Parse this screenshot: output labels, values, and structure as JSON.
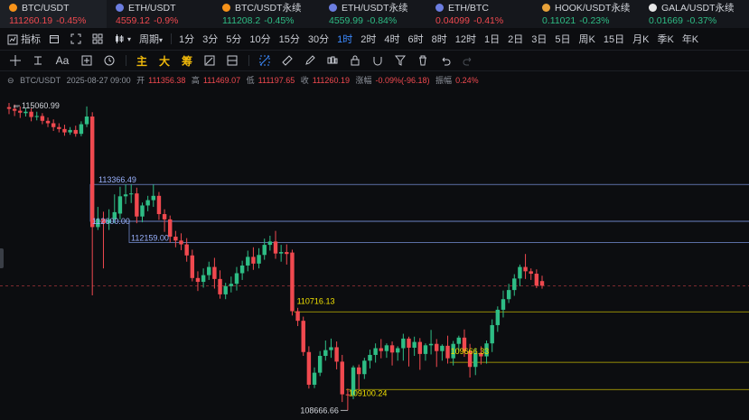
{
  "tickers": [
    {
      "name": "BTC/USDT",
      "price": "111260.19",
      "change": "-0.45%",
      "dir": "down",
      "coin": "#f7931a",
      "active": true
    },
    {
      "name": "ETH/USDT",
      "price": "4559.12",
      "change": "-0.9%",
      "dir": "down",
      "coin": "#6c7ee1",
      "active": false
    },
    {
      "name": "BTC/USDT永续",
      "price": "111208.2",
      "change": "-0.45%",
      "dir": "up",
      "coin": "#f7931a",
      "active": false
    },
    {
      "name": "ETH/USDT永续",
      "price": "4559.99",
      "change": "-0.84%",
      "dir": "up",
      "coin": "#6c7ee1",
      "active": false
    },
    {
      "name": "ETH/BTC",
      "price": "0.04099",
      "change": "-0.41%",
      "dir": "down",
      "coin": "#6c7ee1",
      "active": false
    },
    {
      "name": "HOOK/USDT永续",
      "price": "0.11021",
      "change": "-0.23%",
      "dir": "up",
      "coin": "#e8a23a",
      "active": false
    },
    {
      "name": "GALA/USDT永续",
      "price": "0.01669",
      "change": "-0.37%",
      "dir": "up",
      "coin": "#e8e8e8",
      "active": false
    }
  ],
  "toolbar": {
    "indicators_label": "指标",
    "period_label": "周期",
    "intervals": [
      "1分",
      "3分",
      "5分",
      "10分",
      "15分",
      "30分",
      "1时",
      "2时",
      "4时",
      "6时",
      "8时",
      "12时",
      "1日",
      "2日",
      "3日",
      "5日",
      "周K",
      "15日",
      "月K",
      "季K",
      "年K"
    ],
    "selected_interval": "1时"
  },
  "drawbar": {
    "text_tool": "Aa",
    "labels": [
      "主",
      "大",
      "筹"
    ]
  },
  "info": {
    "symbol": "BTC/USDT",
    "datetime": "2025-08-27 09:00",
    "open_label": "开",
    "open": "111356.38",
    "high_label": "高",
    "high": "111469.07",
    "low_label": "低",
    "low": "111197.65",
    "close_label": "收",
    "close": "111260.19",
    "change_label": "涨幅",
    "change": "-0.09%(-96.18)",
    "amplitude_label": "振幅",
    "amplitude": "0.24%"
  },
  "chart_data": {
    "type": "candlestick",
    "y_range": [
      108560,
      115250
    ],
    "current_price": 111260.19,
    "candles": [
      {
        "o": 114975,
        "h": 115060.99,
        "c": 114940,
        "l": 114830
      },
      {
        "o": 114940,
        "h": 115030,
        "c": 114900,
        "l": 114790
      },
      {
        "o": 114900,
        "h": 114990,
        "c": 114860,
        "l": 114750
      },
      {
        "o": 114850,
        "h": 114960,
        "c": 114880,
        "l": 114780
      },
      {
        "o": 114880,
        "h": 114950,
        "c": 114770,
        "l": 114680
      },
      {
        "o": 114770,
        "h": 114880,
        "c": 114790,
        "l": 114700
      },
      {
        "o": 114790,
        "h": 114850,
        "c": 114690,
        "l": 114620
      },
      {
        "o": 114690,
        "h": 114760,
        "c": 114640,
        "l": 114560
      },
      {
        "o": 114640,
        "h": 114720,
        "c": 114560,
        "l": 114480
      },
      {
        "o": 114560,
        "h": 114640,
        "c": 114520,
        "l": 114450
      },
      {
        "o": 114520,
        "h": 114610,
        "c": 114450,
        "l": 114380
      },
      {
        "o": 114450,
        "h": 114560,
        "c": 114500,
        "l": 114400
      },
      {
        "o": 114500,
        "h": 114590,
        "c": 114420,
        "l": 114360
      },
      {
        "o": 114420,
        "h": 114680,
        "c": 114620,
        "l": 114370
      },
      {
        "o": 114620,
        "h": 114990,
        "c": 114780,
        "l": 114560
      },
      {
        "o": 114780,
        "h": 114870,
        "c": 112480,
        "l": 111060
      },
      {
        "o": 112480,
        "h": 112900,
        "c": 112650,
        "l": 112420
      },
      {
        "o": 112650,
        "h": 112800,
        "c": 112560,
        "l": 111620
      },
      {
        "o": 112560,
        "h": 112850,
        "c": 112640,
        "l": 112420
      },
      {
        "o": 112640,
        "h": 113160,
        "c": 112790,
        "l": 112560
      },
      {
        "o": 112760,
        "h": 113320,
        "c": 113120,
        "l": 112640
      },
      {
        "o": 113120,
        "h": 113370,
        "c": 113160,
        "l": 112960
      },
      {
        "o": 113160,
        "h": 113366.49,
        "c": 113180,
        "l": 112980
      },
      {
        "o": 113180,
        "h": 113300,
        "c": 112700,
        "l": 112560
      },
      {
        "o": 112700,
        "h": 112990,
        "c": 112930,
        "l": 112580
      },
      {
        "o": 112930,
        "h": 113130,
        "c": 113040,
        "l": 112810
      },
      {
        "o": 113040,
        "h": 113366.49,
        "c": 113130,
        "l": 112900
      },
      {
        "o": 113130,
        "h": 113210,
        "c": 112750,
        "l": 112630
      },
      {
        "o": 112750,
        "h": 112850,
        "c": 112640,
        "l": 112380
      },
      {
        "o": 112640,
        "h": 112720,
        "c": 112280,
        "l": 112159
      },
      {
        "o": 112280,
        "h": 112400,
        "c": 112200,
        "l": 112060
      },
      {
        "o": 112200,
        "h": 112350,
        "c": 112120,
        "l": 112000
      },
      {
        "o": 112120,
        "h": 112250,
        "c": 111890,
        "l": 111760
      },
      {
        "o": 111890,
        "h": 112010,
        "c": 111420,
        "l": 111350
      },
      {
        "o": 111420,
        "h": 111560,
        "c": 111340,
        "l": 111150
      },
      {
        "o": 111340,
        "h": 111620,
        "c": 111480,
        "l": 111220
      },
      {
        "o": 111480,
        "h": 111760,
        "c": 111650,
        "l": 111380
      },
      {
        "o": 111650,
        "h": 111840,
        "c": 111400,
        "l": 111200
      },
      {
        "o": 111400,
        "h": 111580,
        "c": 111080,
        "l": 110990
      },
      {
        "o": 111080,
        "h": 111320,
        "c": 111250,
        "l": 110980
      },
      {
        "o": 111250,
        "h": 111450,
        "c": 111300,
        "l": 111120
      },
      {
        "o": 111300,
        "h": 111650,
        "c": 111520,
        "l": 111160
      },
      {
        "o": 111520,
        "h": 111780,
        "c": 111680,
        "l": 111380
      },
      {
        "o": 111680,
        "h": 111990,
        "c": 111860,
        "l": 111560
      },
      {
        "o": 111860,
        "h": 112060,
        "c": 111720,
        "l": 111590
      },
      {
        "o": 111720,
        "h": 112040,
        "c": 111900,
        "l": 111620
      },
      {
        "o": 111900,
        "h": 112240,
        "c": 112110,
        "l": 111800
      },
      {
        "o": 112110,
        "h": 112300,
        "c": 112180,
        "l": 111990
      },
      {
        "o": 112180,
        "h": 112400,
        "c": 111930,
        "l": 111820
      },
      {
        "o": 111930,
        "h": 112110,
        "c": 111960,
        "l": 111760
      },
      {
        "o": 111960,
        "h": 112120,
        "c": 111920,
        "l": 111700
      },
      {
        "o": 111950,
        "h": 112010,
        "c": 110730,
        "l": 110640
      },
      {
        "o": 110730,
        "h": 110800,
        "c": 110530,
        "l": 110420
      },
      {
        "o": 110530,
        "h": 110616.13,
        "c": 109880,
        "l": 109800
      },
      {
        "o": 109880,
        "h": 110000,
        "c": 109200,
        "l": 109120
      },
      {
        "o": 109200,
        "h": 109560,
        "c": 109450,
        "l": 109130
      },
      {
        "o": 109450,
        "h": 109900,
        "c": 109800,
        "l": 109380
      },
      {
        "o": 109800,
        "h": 110120,
        "c": 109920,
        "l": 109700
      },
      {
        "o": 109920,
        "h": 110160,
        "c": 109980,
        "l": 109760
      },
      {
        "o": 109980,
        "h": 110100,
        "c": 109680,
        "l": 109520
      },
      {
        "o": 109680,
        "h": 109820,
        "c": 109000,
        "l": 108840
      },
      {
        "o": 109000,
        "h": 109120,
        "c": 108980,
        "l": 108666.66
      },
      {
        "o": 108980,
        "h": 109600,
        "c": 109560,
        "l": 108900
      },
      {
        "o": 109560,
        "h": 109620,
        "c": 109420,
        "l": 109100.24
      },
      {
        "o": 109420,
        "h": 109760,
        "c": 109700,
        "l": 109320
      },
      {
        "o": 109700,
        "h": 109930,
        "c": 109820,
        "l": 109540
      },
      {
        "o": 109820,
        "h": 110060,
        "c": 109960,
        "l": 109660
      },
      {
        "o": 109960,
        "h": 110150,
        "c": 109900,
        "l": 109750
      },
      {
        "o": 109900,
        "h": 110060,
        "c": 110020,
        "l": 109760
      },
      {
        "o": 110020,
        "h": 110100,
        "c": 109870,
        "l": 109600
      },
      {
        "o": 109870,
        "h": 110000,
        "c": 109960,
        "l": 109700
      },
      {
        "o": 109960,
        "h": 110260,
        "c": 110160,
        "l": 109700
      },
      {
        "o": 110160,
        "h": 110200,
        "c": 109970,
        "l": 109580
      },
      {
        "o": 109970,
        "h": 110200,
        "c": 110090,
        "l": 109800
      },
      {
        "o": 110090,
        "h": 110170,
        "c": 109840,
        "l": 109510
      },
      {
        "o": 109840,
        "h": 110060,
        "c": 110020,
        "l": 109700
      },
      {
        "o": 110020,
        "h": 110340,
        "c": 110050,
        "l": 109830
      },
      {
        "o": 110050,
        "h": 110150,
        "c": 109900,
        "l": 109570
      },
      {
        "o": 109900,
        "h": 110040,
        "c": 110010,
        "l": 109700
      },
      {
        "o": 110010,
        "h": 110220,
        "c": 109750,
        "l": 109640
      },
      {
        "o": 109750,
        "h": 110110,
        "c": 110050,
        "l": 109600
      },
      {
        "o": 110050,
        "h": 110220,
        "c": 110180,
        "l": 109880
      },
      {
        "o": 110180,
        "h": 110350,
        "c": 109900,
        "l": 109780
      },
      {
        "o": 109900,
        "h": 110050,
        "c": 109570,
        "l": 109350
      },
      {
        "o": 109570,
        "h": 109960,
        "c": 109860,
        "l": 109400
      },
      {
        "o": 109860,
        "h": 110000,
        "c": 109790,
        "l": 109620
      },
      {
        "o": 109790,
        "h": 110120,
        "c": 110060,
        "l": 109640
      },
      {
        "o": 110060,
        "h": 110560,
        "c": 110440,
        "l": 109880
      },
      {
        "o": 110440,
        "h": 110830,
        "c": 110760,
        "l": 110300
      },
      {
        "o": 110760,
        "h": 111160,
        "c": 110980,
        "l": 110600
      },
      {
        "o": 110980,
        "h": 111300,
        "c": 111170,
        "l": 110900
      },
      {
        "o": 111170,
        "h": 111500,
        "c": 111410,
        "l": 111050
      },
      {
        "o": 111410,
        "h": 111700,
        "c": 111650,
        "l": 111250
      },
      {
        "o": 111650,
        "h": 111920,
        "c": 111560,
        "l": 111400
      },
      {
        "o": 111560,
        "h": 111620,
        "c": 111510,
        "l": 111380
      },
      {
        "o": 111510,
        "h": 111600,
        "c": 111260.19,
        "l": 111210
      },
      {
        "o": 111356.38,
        "h": 111469.07,
        "c": 111260.19,
        "l": 111197.65
      }
    ],
    "boxes": [
      {
        "label": "113366.49",
        "top": 113366.49,
        "bottom": 112600.0,
        "label_color": "#9bb3ff",
        "mid_label": "112600.00"
      },
      {
        "label": "112159.00",
        "top": 112600.0,
        "bottom": 112159.0,
        "label_color": "#9bb3ff"
      }
    ],
    "levels": [
      {
        "label": "110716.13",
        "price": 110716.13,
        "color": "#f0e000"
      },
      {
        "label": "109666.33",
        "price": 109666.33,
        "color": "#f0e000"
      },
      {
        "label": "109100.24",
        "price": 109100.24,
        "color": "#f0e000"
      }
    ],
    "extremes": {
      "high_label": "115060.99",
      "high": 115060.99,
      "low_label": "108666.66",
      "low": 108666.66
    }
  }
}
